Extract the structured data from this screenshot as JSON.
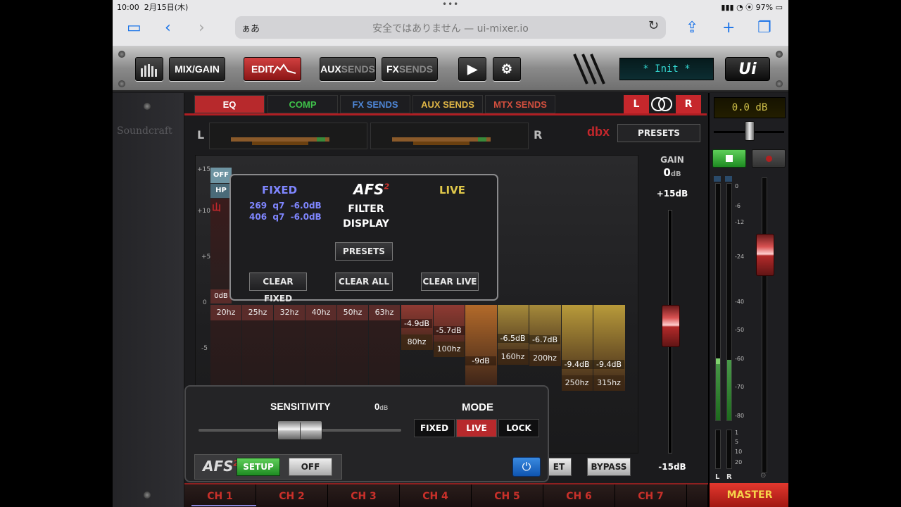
{
  "status": {
    "time": "10:00",
    "date": "2月15日(木)",
    "battery": "97%"
  },
  "browser": {
    "aa": "ぁあ",
    "address": "安全ではありません — ui-mixer.io"
  },
  "toolbar": {
    "mix_gain": "MIX/GAIN",
    "edit": "EDIT",
    "aux_a": "AUX",
    "aux_b": "SENDS",
    "fx_a": "FX",
    "fx_b": "SENDS",
    "snapshot": "* Init *",
    "logo": "Ui"
  },
  "brand": "Soundcraft",
  "tabs": [
    {
      "label": "EQ",
      "color": "#ffffff"
    },
    {
      "label": "COMP",
      "color": "#3fc24a"
    },
    {
      "label": "FX SENDS",
      "color": "#4e86d6"
    },
    {
      "label": "AUX SENDS",
      "color": "#e0b646"
    },
    {
      "label": "MTX SENDS",
      "color": "#d24f3e"
    }
  ],
  "link": {
    "l": "L",
    "r": "R"
  },
  "meters": {
    "l": "L",
    "r": "R",
    "dbx": "dbx",
    "presets": "PRESETS"
  },
  "graph": {
    "y_labels": [
      "+15",
      "+10",
      "+5",
      "0",
      "-5"
    ],
    "off": "OFF",
    "hp": "HP",
    "odb": "0dB",
    "fixed_freqs": [
      "20hz",
      "25hz",
      "32hz",
      "40hz",
      "50hz",
      "63hz"
    ],
    "live": [
      {
        "freq": "80hz",
        "gain": "-4.9dB",
        "level": -4.9
      },
      {
        "freq": "100hz",
        "gain": "-5.7dB",
        "level": -5.7
      },
      {
        "freq": "",
        "gain": "-9dB",
        "level": -9
      },
      {
        "freq": "160hz",
        "gain": "-6.5dB",
        "level": -6.5
      },
      {
        "freq": "200hz",
        "gain": "-6.7dB",
        "level": -6.7
      },
      {
        "freq": "250hz",
        "gain": "-9.4dB",
        "level": -9.4
      },
      {
        "freq": "315hz",
        "gain": "-9.4dB",
        "level": -9.4
      }
    ]
  },
  "gain": {
    "title": "GAIN",
    "value": "0",
    "unit": "dB",
    "top": "+15dB",
    "bottom": "-15dB",
    "level": 0
  },
  "afs": {
    "fixed_title": "FIXED",
    "logo": "AFS",
    "sup": "2",
    "filter": "FILTER",
    "display": "DISPLAY",
    "live_title": "LIVE",
    "filters": [
      {
        "freq": "269",
        "q": "q7",
        "gain": "-6.0dB"
      },
      {
        "freq": "406",
        "q": "q7",
        "gain": "-6.0dB"
      }
    ],
    "presets": "PRESETS",
    "clear_fixed": "CLEAR FIXED",
    "clear_all": "CLEAR ALL",
    "clear_live": "CLEAR LIVE"
  },
  "panel": {
    "sensitivity": "SENSITIVITY",
    "sens_value": "0",
    "sens_unit": "dB",
    "mode": "MODE",
    "modes": [
      "FIXED",
      "LIVE",
      "LOCK"
    ],
    "active_mode": "LIVE",
    "setup": "SETUP",
    "off": "OFF",
    "afs_logo": "AFS",
    "afs_sup": "2"
  },
  "buttons": {
    "reset_partial": "ET",
    "bypass": "BYPASS"
  },
  "channels": [
    "CH 1",
    "CH 2",
    "CH 3",
    "CH 4",
    "CH 5",
    "CH 6",
    "CH 7"
  ],
  "master": {
    "lcd": "0.0 dB",
    "label": "MASTER",
    "scale": [
      "0",
      "-6",
      "-12",
      "-24",
      "-40",
      "-50",
      "-60",
      "-70",
      "-80"
    ],
    "scale2": [
      "1",
      "5",
      "10",
      "20"
    ],
    "l": "L",
    "r": "R"
  }
}
